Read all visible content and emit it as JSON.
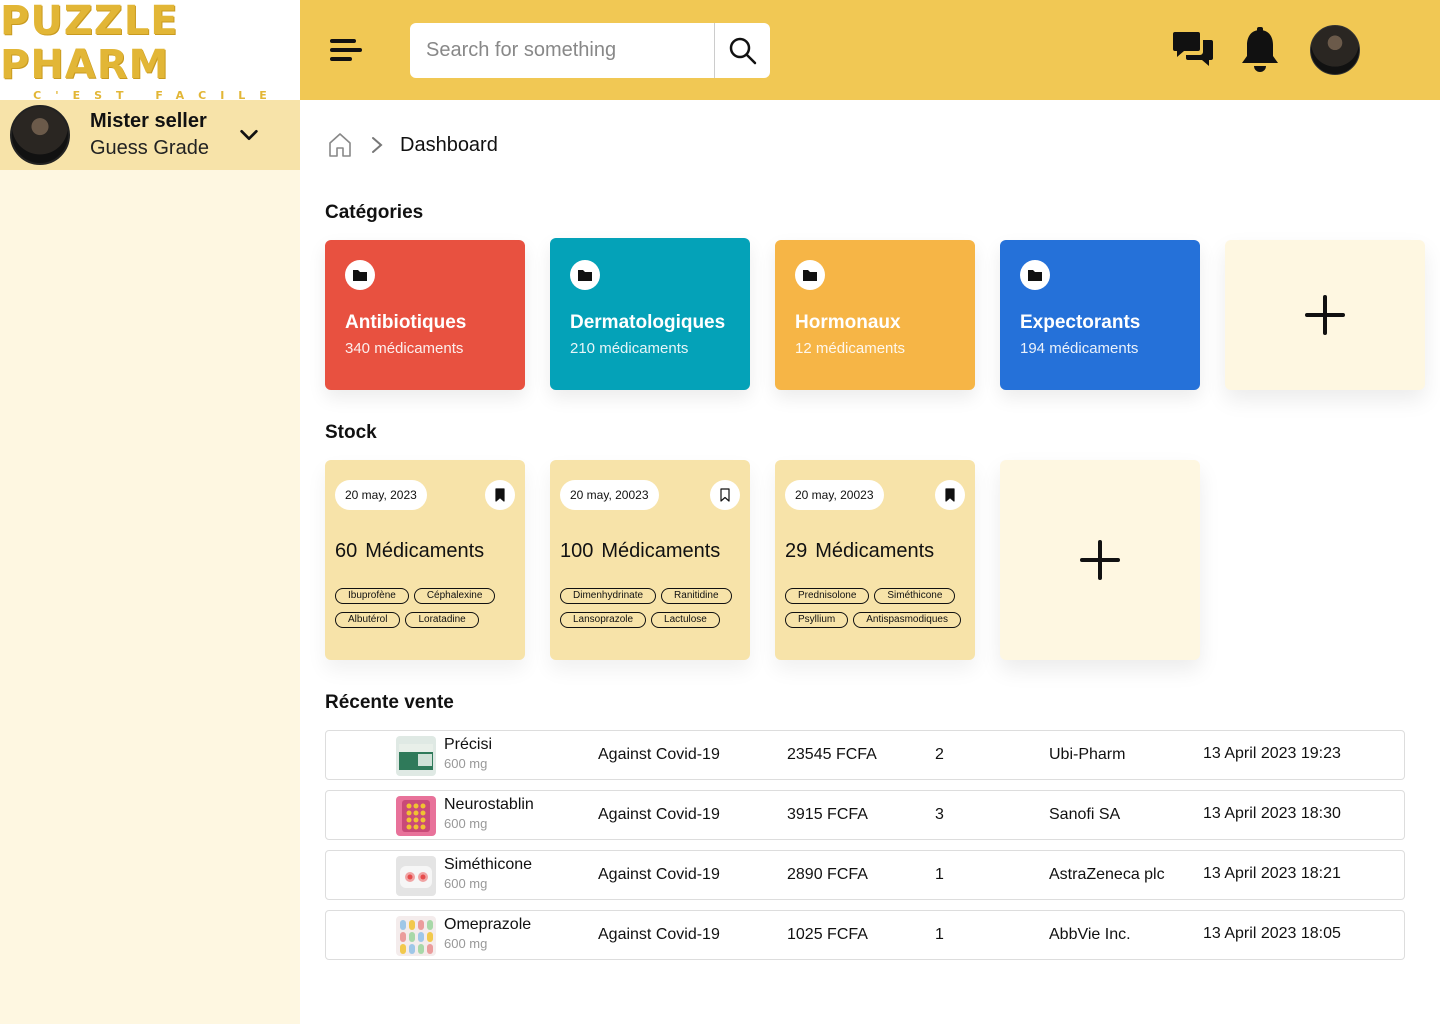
{
  "logo": {
    "title": "PUZZLE PHARM",
    "subtitle": "C'EST FACILE"
  },
  "user": {
    "name": "Mister seller",
    "grade": "Guess Grade"
  },
  "search": {
    "placeholder": "Search for something"
  },
  "breadcrumb": {
    "current": "Dashboard"
  },
  "sections": {
    "categories": "Catégories",
    "stock": "Stock",
    "recent_sales": "Récente vente"
  },
  "categories": [
    {
      "name": "Antibiotiques",
      "count": "340 médicaments",
      "color": "#E85140"
    },
    {
      "name": "Dermatologiques",
      "count": "210 médicaments",
      "color": "#04A2B8"
    },
    {
      "name": "Hormonaux",
      "count": "12 médicaments",
      "color": "#F6B546"
    },
    {
      "name": "Expectorants",
      "count": "194 médicaments",
      "color": "#2571D9"
    }
  ],
  "stock": [
    {
      "date": "20 may, 2023",
      "count": "60",
      "label": "Médicaments",
      "bookmarked": true,
      "tags": [
        "Ibuprofène",
        "Céphalexine",
        "Albutérol",
        "Loratadine"
      ]
    },
    {
      "date": "20 may, 20023",
      "count": "100",
      "label": "Médicaments",
      "bookmarked": false,
      "tags": [
        "Dimenhydrinate",
        "Ranitidine",
        "Lansoprazole",
        "Lactulose"
      ]
    },
    {
      "date": "20 may, 20023",
      "count": "29",
      "label": "Médicaments",
      "bookmarked": true,
      "tags": [
        "Prednisolone",
        "Siméthicone",
        "Psyllium",
        "Antispasmodiques"
      ]
    }
  ],
  "sales": [
    {
      "name": "Précisi",
      "dose": "600 mg",
      "use": "Against Covid-19",
      "price": "23545 FCFA",
      "qty": "2",
      "supplier": "Ubi-Pharm",
      "datetime": "13 April 2023 19:23",
      "thumb": "green-box"
    },
    {
      "name": "Neurostablin",
      "dose": "600 mg",
      "use": "Against Covid-19",
      "price": "3915 FCFA",
      "qty": "3",
      "supplier": "Sanofi SA",
      "datetime": "13 April 2023 18:30",
      "thumb": "pink-blister"
    },
    {
      "name": "Siméthicone",
      "dose": "600 mg",
      "use": "Against Covid-19",
      "price": "2890 FCFA",
      "qty": "1",
      "supplier": "AstraZeneca plc",
      "datetime": "13 April 2023 18:21",
      "thumb": "white-blister"
    },
    {
      "name": "Omeprazole",
      "dose": "600 mg",
      "use": "Against Covid-19",
      "price": "1025 FCFA",
      "qty": "1",
      "supplier": "AbbVie Inc.",
      "datetime": "13 April 2023 18:05",
      "thumb": "capsules"
    }
  ],
  "colors": {
    "header": "#F1C854",
    "sidebar": "#FEF7E1",
    "user_box": "#F7E3A9",
    "stock_card": "#F7E3A9"
  }
}
